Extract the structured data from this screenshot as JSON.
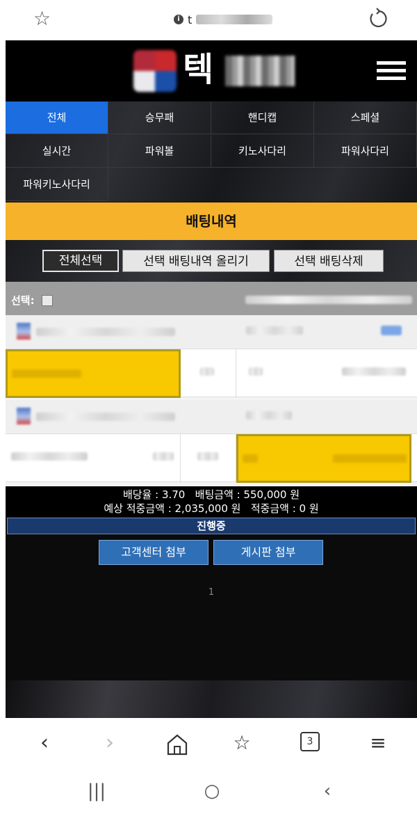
{
  "browser": {
    "url_prefix": "t",
    "info_glyph": "i",
    "tab_count": "3"
  },
  "site": {
    "logo_char": "텍",
    "nav": [
      {
        "label": "전체",
        "active": true
      },
      {
        "label": "승무패"
      },
      {
        "label": "핸디캡"
      },
      {
        "label": "스페셜"
      },
      {
        "label": "실시간"
      },
      {
        "label": "파워볼"
      },
      {
        "label": "키노사다리"
      },
      {
        "label": "파워사다리"
      },
      {
        "label": "파워키노사다리"
      }
    ],
    "page_title": "배팅내역",
    "actions": {
      "select_all": "전체선택",
      "upload_selected": "선택 배팅내역 올리기",
      "delete_selected": "선택 배팅삭제"
    },
    "list": {
      "select_label": "선택:"
    },
    "summary": {
      "line1": "배당율 : 3.70   배팅금액 : 550,000 원",
      "line2": "예상 적중금액 : 2,035,000 원   적중금액 : 0 원"
    },
    "status": "진행중",
    "attach": {
      "cs": "고객센터 첨부",
      "board": "게시판 첨부"
    },
    "pager": "1"
  },
  "colors": {
    "active_tab": "#1c6de0",
    "title_bar": "#f6b22a",
    "highlight": "#f8c800",
    "status_bg": "#1a3a6e",
    "attach_bg": "#2f6fb6"
  }
}
